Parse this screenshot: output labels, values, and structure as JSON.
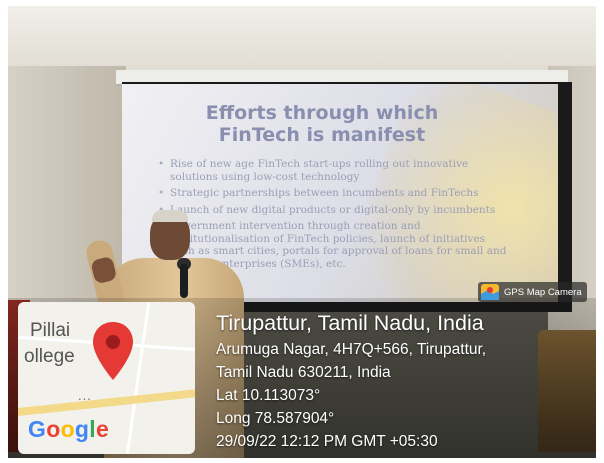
{
  "slide": {
    "title_line1": "Efforts through which",
    "title_line2": "FinTech is manifest",
    "bullets": [
      "Rise of new age FinTech start-ups rolling out innovative solutions using low-cost technology",
      "Strategic partnerships between incumbents and FinTechs",
      "Launch of new digital products or digital-only by incumbents",
      "Government intervention through creation and institutionalisation of FinTech policies, launch of initiatives such as smart cities, portals for approval of loans for small and medium enterprises (SMEs), etc."
    ]
  },
  "map": {
    "label_line1": "Pillai",
    "label_line2": "ollege",
    "dots": "...",
    "pin_icon": "map-pin-icon",
    "pin_color": "#e53935"
  },
  "google_logo": {
    "letters": [
      "G",
      "o",
      "o",
      "g",
      "l",
      "e"
    ],
    "colors": [
      "#4285f4",
      "#ea4335",
      "#fbbc05",
      "#4285f4",
      "#34a853",
      "#ea4335"
    ]
  },
  "gps_badge": {
    "icon": "gps-map-camera-icon",
    "label": "GPS Map Camera"
  },
  "location": {
    "place": "Tirupattur, Tamil Nadu, India",
    "address_line1": "Arumuga Nagar, 4H7Q+566, Tirupattur,",
    "address_line2": "Tamil Nadu 630211, India",
    "lat": "Lat 10.113073°",
    "long": "Long 78.587904°",
    "datetime": "29/09/22 12:12 PM GMT +05:30"
  }
}
